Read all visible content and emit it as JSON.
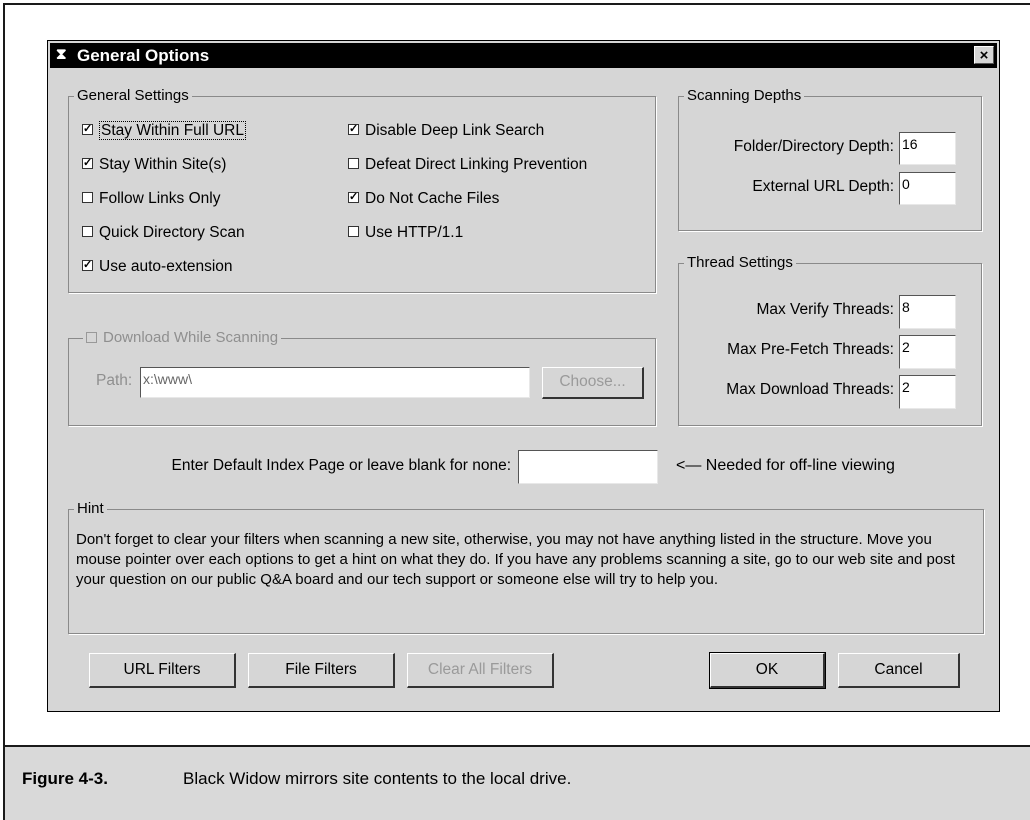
{
  "dialog": {
    "title": "General Options",
    "close_glyph": "×",
    "icon": "hourglass-icon"
  },
  "general_settings": {
    "legend": "General Settings",
    "left": [
      {
        "label": "Stay Within Full URL",
        "checked": true
      },
      {
        "label": "Stay Within Site(s)",
        "checked": true
      },
      {
        "label": "Follow Links Only",
        "checked": false
      },
      {
        "label": "Quick Directory Scan",
        "checked": false
      },
      {
        "label": "Use auto-extension",
        "checked": true
      }
    ],
    "right": [
      {
        "label": "Disable Deep Link Search",
        "checked": true
      },
      {
        "label": "Defeat Direct Linking Prevention",
        "checked": false
      },
      {
        "label": "Do Not Cache Files",
        "checked": true
      },
      {
        "label": "Use HTTP/1.1",
        "checked": false
      }
    ]
  },
  "download": {
    "legend": "Download While Scanning",
    "checked": false,
    "path_label": "Path:",
    "path_value": "x:\\www\\",
    "choose_label": "Choose..."
  },
  "scanning_depths": {
    "legend": "Scanning Depths",
    "folder_label": "Folder/Directory Depth:",
    "folder_value": "16",
    "external_label": "External URL Depth:",
    "external_value": "0"
  },
  "thread_settings": {
    "legend": "Thread Settings",
    "verify_label": "Max Verify Threads:",
    "verify_value": "8",
    "prefetch_label": "Max Pre-Fetch Threads:",
    "prefetch_value": "2",
    "download_label": "Max Download Threads:",
    "download_value": "2"
  },
  "index_page": {
    "label": "Enter Default Index Page or leave blank for none:",
    "value": "",
    "note": "<— Needed for off-line viewing"
  },
  "hint": {
    "legend": "Hint",
    "text": "Don't forget to clear your filters when scanning a new site, otherwise, you may not have anything listed in the structure. Move you mouse pointer over each options to get a hint on what they do. If you have any problems scanning a site, go to our web site and post your question on our public Q&A board and our tech support or someone else will try to help you."
  },
  "buttons": {
    "url_filters": "URL Filters",
    "file_filters": "File Filters",
    "clear_filters": "Clear All Filters",
    "ok": "OK",
    "cancel": "Cancel"
  },
  "caption": {
    "number": "Figure 4-3.",
    "text": "Black Widow mirrors site contents to the local drive."
  }
}
